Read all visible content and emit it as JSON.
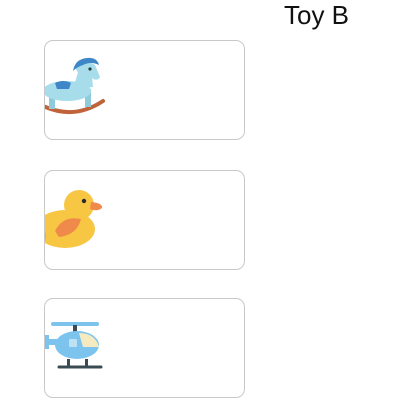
{
  "header": {
    "title": "Toy B"
  },
  "cards": [
    {
      "icon": "rocking-horse-icon"
    },
    {
      "icon": "rubber-duck-icon"
    },
    {
      "icon": "toy-helicopter-icon"
    }
  ],
  "colors": {
    "card_border": "#c8c8c8",
    "horse_body": "#a7dcea",
    "horse_mane": "#3f86c9",
    "rocker": "#c0623a",
    "duck_body": "#f7c744",
    "duck_wing": "#ef8a4a",
    "heli_body": "#7cc4ee",
    "heli_window": "#f6ebc0",
    "heli_dark": "#3b4b56"
  }
}
